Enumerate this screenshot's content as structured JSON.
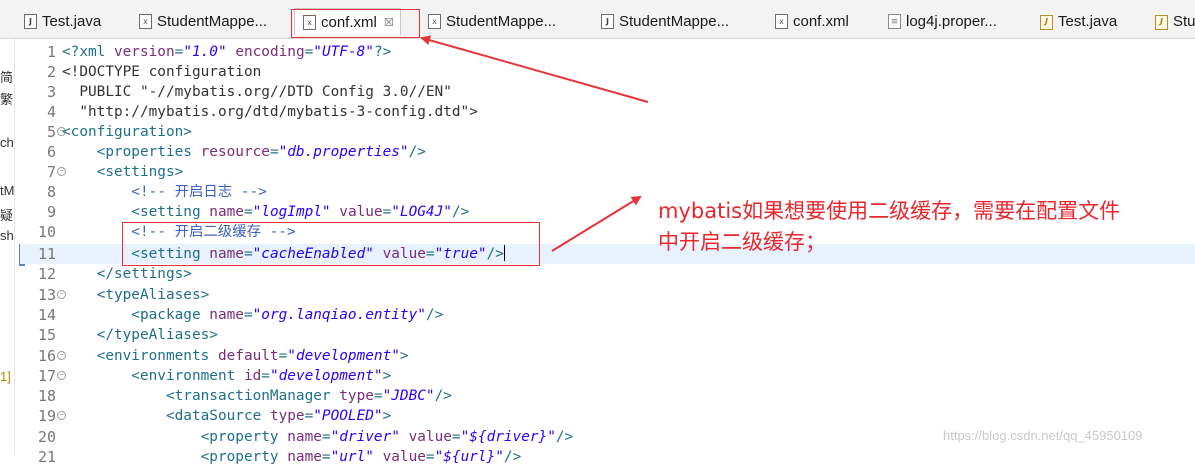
{
  "tabs": [
    {
      "label": "Test.java",
      "icon": "java-file-icon",
      "active": false
    },
    {
      "label": "StudentMappe...",
      "icon": "xml-file-icon",
      "active": false
    },
    {
      "label": "conf.xml",
      "icon": "xml-file-icon",
      "active": true
    },
    {
      "label": "StudentMappe...",
      "icon": "xml-file-icon",
      "active": false
    },
    {
      "label": "StudentMappe...",
      "icon": "java-file-icon",
      "active": false
    },
    {
      "label": "conf.xml",
      "icon": "xml-file-icon",
      "active": false
    },
    {
      "label": "log4j.proper...",
      "icon": "properties-file-icon",
      "active": false
    },
    {
      "label": "Test.java",
      "icon": "java-file-icon",
      "active": false
    },
    {
      "label": "Stu",
      "icon": "java-file-icon",
      "active": false
    }
  ],
  "tab_close_glyph": "☒",
  "left_panel_fragments": [
    "简",
    "繁",
    "ch",
    "tM",
    "疑",
    "sh",
    "1]"
  ],
  "editor": {
    "line_numbers": [
      "1",
      "2",
      "3",
      "4",
      "5",
      "6",
      "7",
      "8",
      "9",
      "10",
      "11",
      "12",
      "13",
      "14",
      "15",
      "16",
      "17",
      "18",
      "19",
      "20",
      "21"
    ],
    "current_line": "11",
    "lines": {
      "l1": {
        "s1": "<?xml ",
        "s2": "version",
        "s3": "=",
        "s4": "\"1.0\"",
        "s5": " ",
        "s6": "encoding",
        "s7": "=",
        "s8": "\"UTF-8\"",
        "s9": "?>"
      },
      "l2": {
        "s1": "<!DOCTYPE configuration"
      },
      "l3": {
        "s1": "  PUBLIC ",
        "s2": "\"-//mybatis.org//DTD Config 3.0//EN\""
      },
      "l4": {
        "s1": "  ",
        "s2": "\"http://mybatis.org/dtd/mybatis-3-config.dtd\"",
        "s3": ">"
      },
      "l5": {
        "s1": "<configuration>"
      },
      "l6": {
        "s1": "    <properties ",
        "s2": "resource",
        "s3": "=",
        "s4": "\"db.properties\"",
        "s5": "/>"
      },
      "l7": {
        "s1": "    <settings>"
      },
      "l8": {
        "s1": "        <!-- 开启日志 -->"
      },
      "l9": {
        "s1": "        <setting ",
        "s2": "name",
        "s3": "=",
        "s4": "\"logImpl\"",
        "s5": " ",
        "s6": "value",
        "s7": "=",
        "s8": "\"LOG4J\"",
        "s9": "/>"
      },
      "l10": {
        "s1": "        <!-- 开启二级缓存 -->"
      },
      "l11": {
        "s1": "        <setting ",
        "s2": "name",
        "s3": "=",
        "s4": "\"cacheEnabled\"",
        "s5": " ",
        "s6": "value",
        "s7": "=",
        "s8": "\"true\"",
        "s9": "/>"
      },
      "l12": {
        "s1": "    </settings>"
      },
      "l13": {
        "s1": "    <typeAliases>"
      },
      "l14": {
        "s1": "        <package ",
        "s2": "name",
        "s3": "=",
        "s4": "\"org.lanqiao.entity\"",
        "s5": "/>"
      },
      "l15": {
        "s1": "    </typeAliases>"
      },
      "l16": {
        "s1": "    <environments ",
        "s2": "default",
        "s3": "=",
        "s4": "\"development\"",
        "s5": ">"
      },
      "l17": {
        "s1": "        <environment ",
        "s2": "id",
        "s3": "=",
        "s4": "\"development\"",
        "s5": ">"
      },
      "l18": {
        "s1": "            <transactionManager ",
        "s2": "type",
        "s3": "=",
        "s4": "\"JDBC\"",
        "s5": "/>"
      },
      "l19": {
        "s1": "            <dataSource ",
        "s2": "type",
        "s3": "=",
        "s4": "\"POOLED\"",
        "s5": ">"
      },
      "l20": {
        "s1": "                <property ",
        "s2": "name",
        "s3": "=",
        "s4": "\"driver\"",
        "s5": " ",
        "s6": "value",
        "s7": "=",
        "s8": "\"${driver}\"",
        "s9": "/>"
      },
      "l21": {
        "s1": "                <property ",
        "s2": "name",
        "s3": "=",
        "s4": "\"url\"",
        "s5": " ",
        "s6": "value",
        "s7": "=",
        "s8": "\"${url}\"",
        "s9": "/>"
      }
    }
  },
  "annotation": {
    "line1": "mybatis如果想要使用二级缓存，需要在配置文件",
    "line2": "中开启二级缓存；"
  },
  "watermark": "https://blog.csdn.net/qq_45950109",
  "colors": {
    "annotation_red": "#e3343a",
    "tag": "#1f6f8b",
    "attr": "#7a2d7a",
    "value": "#2a00ff",
    "comment": "#3f5fbf"
  }
}
